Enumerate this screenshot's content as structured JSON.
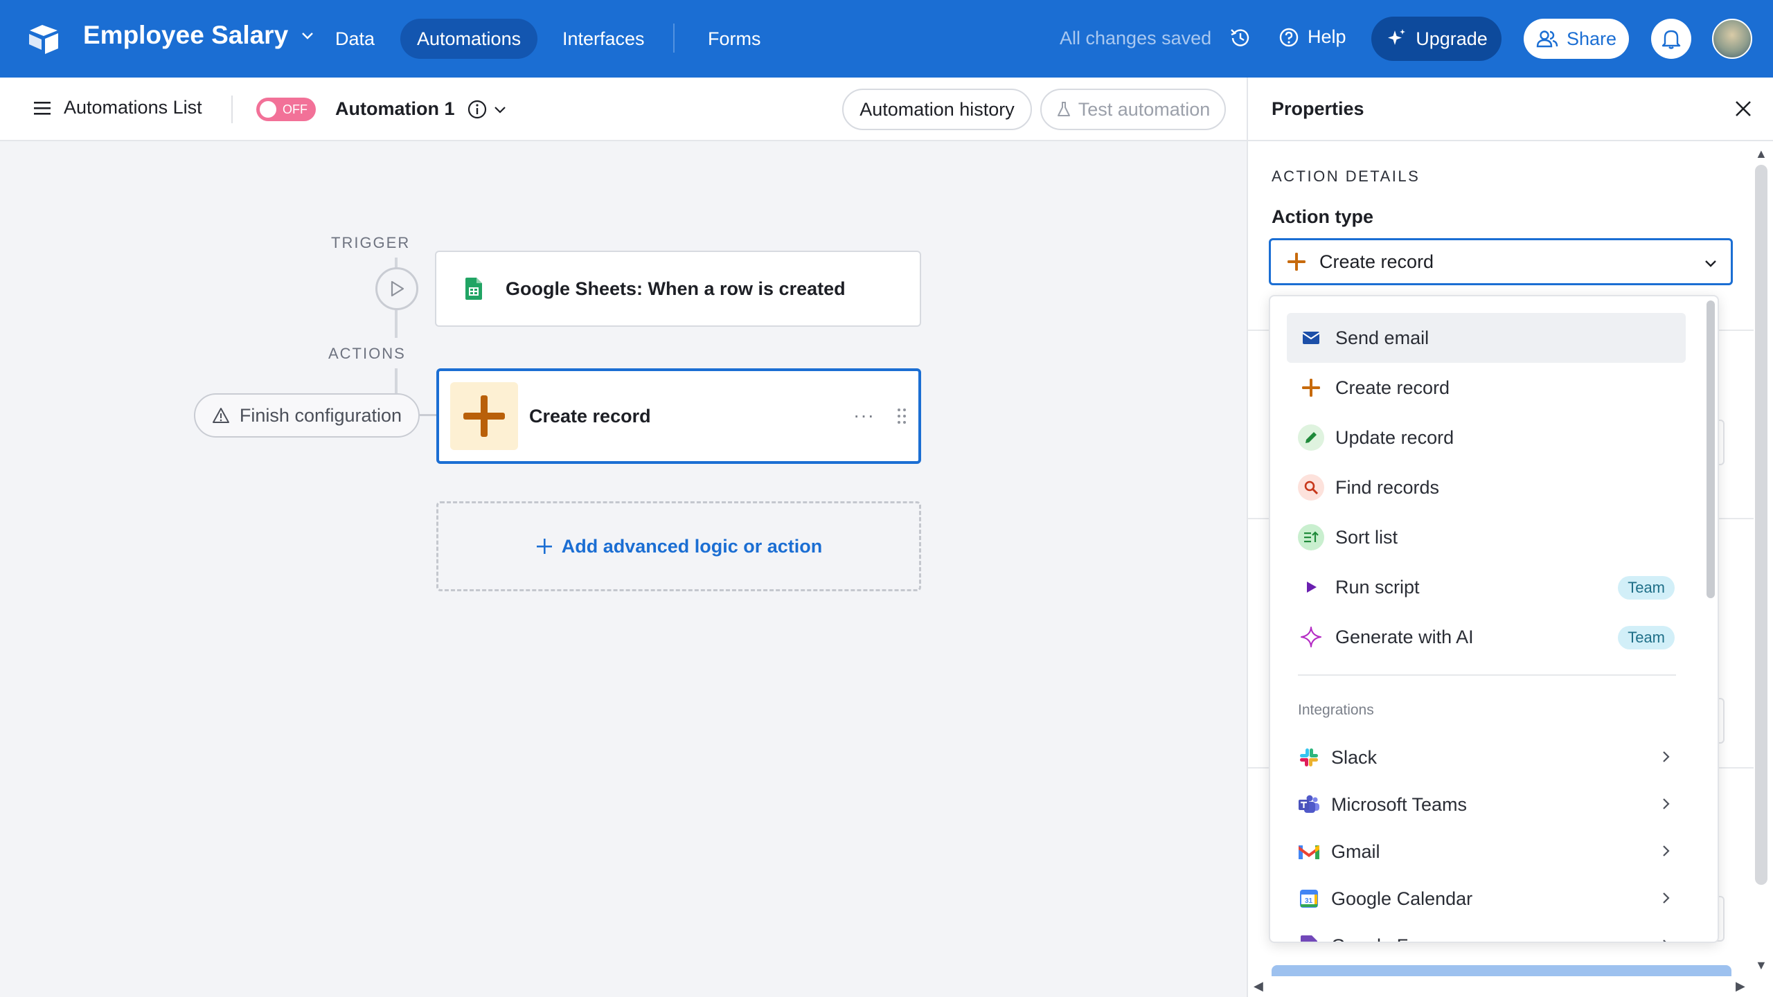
{
  "topbar": {
    "base_name": "Employee Salary",
    "tabs": [
      {
        "label": "Data",
        "active": false
      },
      {
        "label": "Automations",
        "active": true
      },
      {
        "label": "Interfaces",
        "active": false
      },
      {
        "label": "Forms",
        "active": false
      }
    ],
    "save_status": "All changes saved",
    "help_label": "Help",
    "upgrade_label": "Upgrade",
    "share_label": "Share",
    "brand_color": "#1b6ed3"
  },
  "subbar": {
    "list_label": "Automations List",
    "toggle_state": "OFF",
    "automation_name": "Automation 1",
    "history_label": "Automation history",
    "test_label": "Test automation"
  },
  "canvas": {
    "trigger_label": "TRIGGER",
    "actions_label": "ACTIONS",
    "trigger_text": "Google Sheets: When a row is created",
    "action_text": "Create record",
    "finish_label": "Finish configuration",
    "add_label": "Add advanced logic or action"
  },
  "panel": {
    "title": "Properties",
    "section_title": "ACTION DETAILS",
    "action_type_label": "Action type",
    "selected_value": "Create record"
  },
  "dropdown": {
    "items": [
      {
        "label": "Send email",
        "icon": "mail-icon",
        "badge": ""
      },
      {
        "label": "Create record",
        "icon": "plus-icon",
        "badge": ""
      },
      {
        "label": "Update record",
        "icon": "pencil-icon",
        "badge": ""
      },
      {
        "label": "Find records",
        "icon": "search-icon",
        "badge": ""
      },
      {
        "label": "Sort list",
        "icon": "sort-icon",
        "badge": ""
      },
      {
        "label": "Run script",
        "icon": "play-icon",
        "badge": "Team"
      },
      {
        "label": "Generate with AI",
        "icon": "sparkle-icon",
        "badge": "Team"
      }
    ],
    "section_label": "Integrations",
    "integrations": [
      {
        "label": "Slack",
        "icon": "slack-icon"
      },
      {
        "label": "Microsoft Teams",
        "icon": "teams-icon"
      },
      {
        "label": "Gmail",
        "icon": "gmail-icon"
      },
      {
        "label": "Google Calendar",
        "icon": "calendar-icon"
      },
      {
        "label": "Google Forms",
        "icon": "forms-icon"
      }
    ]
  }
}
